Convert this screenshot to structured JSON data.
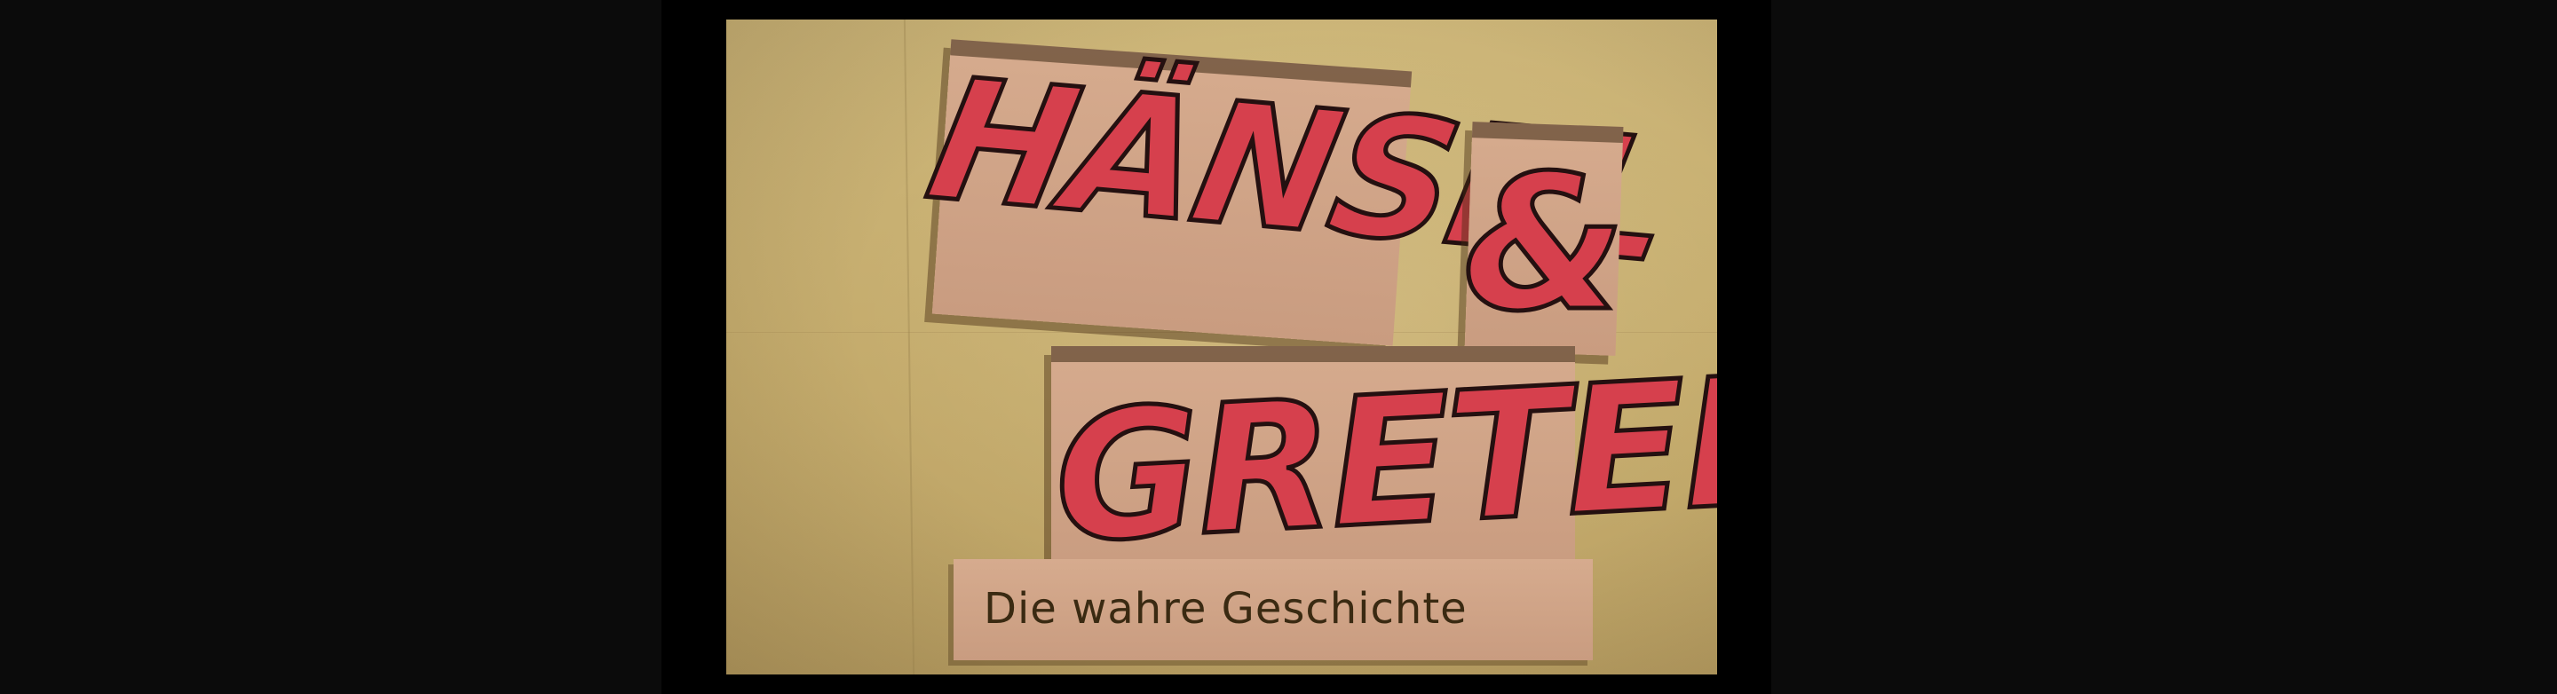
{
  "artwork": {
    "title_line1": "HÄNSEL",
    "ampersand": "&",
    "title_line2": "GRETEL",
    "subtitle": "Die wahre Geschichte"
  },
  "colors": {
    "background": "#070707",
    "paper": "#c8ae6f",
    "panel": "#d3a88b",
    "letter_fill": "#d6404d",
    "outline": "#241010"
  }
}
